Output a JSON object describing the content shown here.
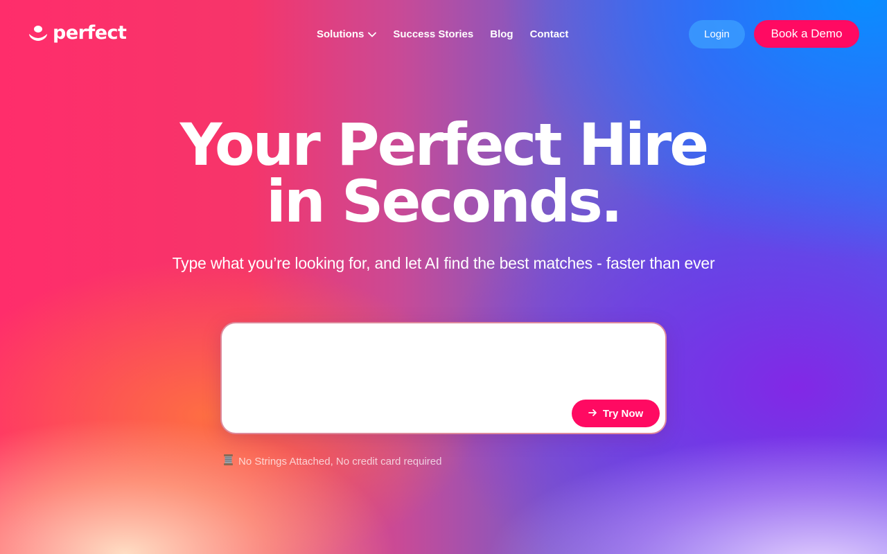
{
  "brand": {
    "name": "perfect",
    "logo_icon": "smile-bowl-icon"
  },
  "nav": {
    "items": [
      {
        "label": "Solutions",
        "has_dropdown": true
      },
      {
        "label": "Success Stories"
      },
      {
        "label": "Blog"
      },
      {
        "label": "Contact"
      }
    ]
  },
  "header_actions": {
    "login_label": "Login",
    "demo_label": "Book a Demo"
  },
  "hero": {
    "title_line1": "Your Perfect Hire",
    "title_line2": "in Seconds.",
    "subtitle": "Type what you’re looking for, and let AI find the best matches - faster than ever"
  },
  "search": {
    "value": "",
    "placeholder": "",
    "button_label": "Try Now",
    "button_icon": "arrow-right-icon"
  },
  "note": {
    "icon": "thread-spool-icon",
    "text": "No Strings Attached, No credit card required"
  },
  "colors": {
    "accent": "#ff0a62",
    "login_bg": "#3ca0ff",
    "text": "#ffffff"
  }
}
